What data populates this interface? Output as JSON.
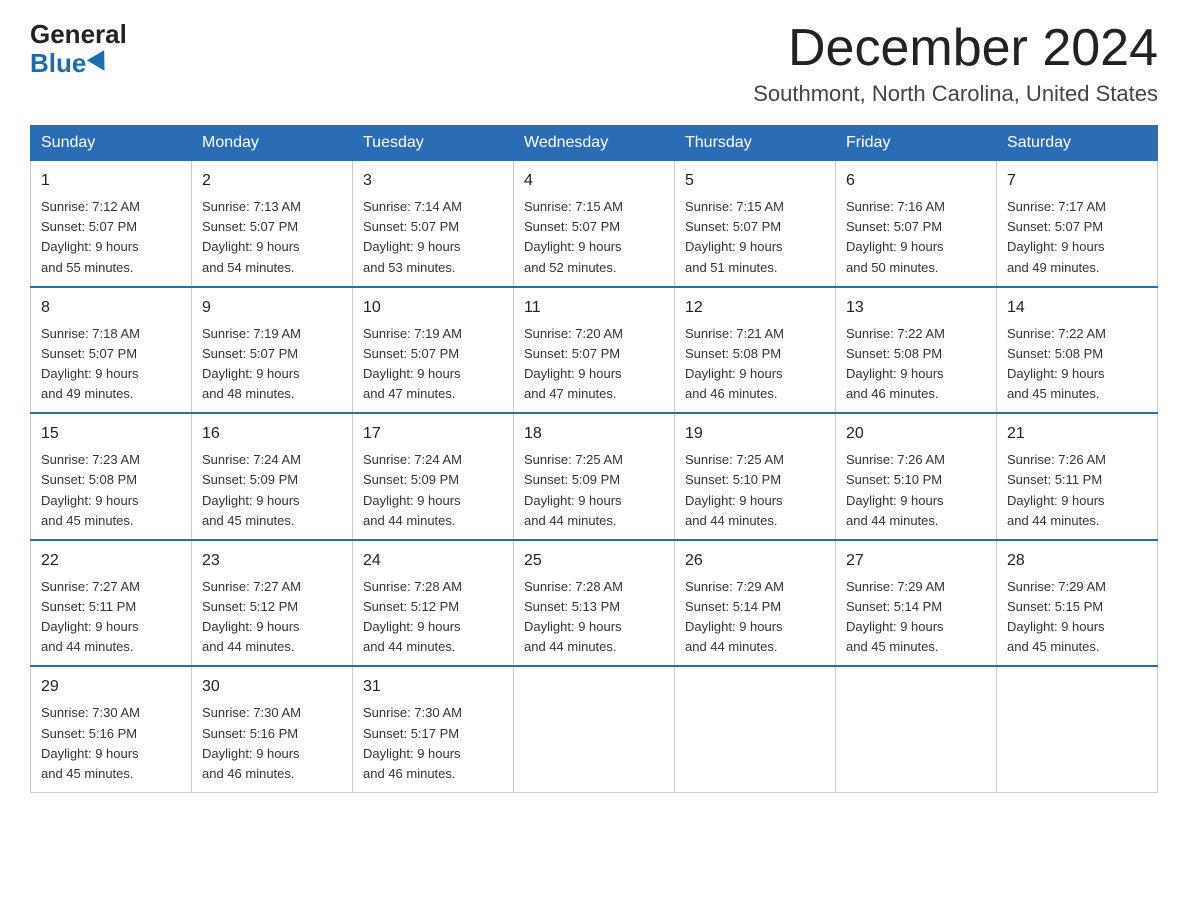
{
  "logo": {
    "general": "General",
    "blue": "Blue"
  },
  "title": "December 2024",
  "subtitle": "Southmont, North Carolina, United States",
  "weekdays": [
    "Sunday",
    "Monday",
    "Tuesday",
    "Wednesday",
    "Thursday",
    "Friday",
    "Saturday"
  ],
  "weeks": [
    [
      {
        "day": "1",
        "sunrise": "7:12 AM",
        "sunset": "5:07 PM",
        "daylight": "9 hours and 55 minutes."
      },
      {
        "day": "2",
        "sunrise": "7:13 AM",
        "sunset": "5:07 PM",
        "daylight": "9 hours and 54 minutes."
      },
      {
        "day": "3",
        "sunrise": "7:14 AM",
        "sunset": "5:07 PM",
        "daylight": "9 hours and 53 minutes."
      },
      {
        "day": "4",
        "sunrise": "7:15 AM",
        "sunset": "5:07 PM",
        "daylight": "9 hours and 52 minutes."
      },
      {
        "day": "5",
        "sunrise": "7:15 AM",
        "sunset": "5:07 PM",
        "daylight": "9 hours and 51 minutes."
      },
      {
        "day": "6",
        "sunrise": "7:16 AM",
        "sunset": "5:07 PM",
        "daylight": "9 hours and 50 minutes."
      },
      {
        "day": "7",
        "sunrise": "7:17 AM",
        "sunset": "5:07 PM",
        "daylight": "9 hours and 49 minutes."
      }
    ],
    [
      {
        "day": "8",
        "sunrise": "7:18 AM",
        "sunset": "5:07 PM",
        "daylight": "9 hours and 49 minutes."
      },
      {
        "day": "9",
        "sunrise": "7:19 AM",
        "sunset": "5:07 PM",
        "daylight": "9 hours and 48 minutes."
      },
      {
        "day": "10",
        "sunrise": "7:19 AM",
        "sunset": "5:07 PM",
        "daylight": "9 hours and 47 minutes."
      },
      {
        "day": "11",
        "sunrise": "7:20 AM",
        "sunset": "5:07 PM",
        "daylight": "9 hours and 47 minutes."
      },
      {
        "day": "12",
        "sunrise": "7:21 AM",
        "sunset": "5:08 PM",
        "daylight": "9 hours and 46 minutes."
      },
      {
        "day": "13",
        "sunrise": "7:22 AM",
        "sunset": "5:08 PM",
        "daylight": "9 hours and 46 minutes."
      },
      {
        "day": "14",
        "sunrise": "7:22 AM",
        "sunset": "5:08 PM",
        "daylight": "9 hours and 45 minutes."
      }
    ],
    [
      {
        "day": "15",
        "sunrise": "7:23 AM",
        "sunset": "5:08 PM",
        "daylight": "9 hours and 45 minutes."
      },
      {
        "day": "16",
        "sunrise": "7:24 AM",
        "sunset": "5:09 PM",
        "daylight": "9 hours and 45 minutes."
      },
      {
        "day": "17",
        "sunrise": "7:24 AM",
        "sunset": "5:09 PM",
        "daylight": "9 hours and 44 minutes."
      },
      {
        "day": "18",
        "sunrise": "7:25 AM",
        "sunset": "5:09 PM",
        "daylight": "9 hours and 44 minutes."
      },
      {
        "day": "19",
        "sunrise": "7:25 AM",
        "sunset": "5:10 PM",
        "daylight": "9 hours and 44 minutes."
      },
      {
        "day": "20",
        "sunrise": "7:26 AM",
        "sunset": "5:10 PM",
        "daylight": "9 hours and 44 minutes."
      },
      {
        "day": "21",
        "sunrise": "7:26 AM",
        "sunset": "5:11 PM",
        "daylight": "9 hours and 44 minutes."
      }
    ],
    [
      {
        "day": "22",
        "sunrise": "7:27 AM",
        "sunset": "5:11 PM",
        "daylight": "9 hours and 44 minutes."
      },
      {
        "day": "23",
        "sunrise": "7:27 AM",
        "sunset": "5:12 PM",
        "daylight": "9 hours and 44 minutes."
      },
      {
        "day": "24",
        "sunrise": "7:28 AM",
        "sunset": "5:12 PM",
        "daylight": "9 hours and 44 minutes."
      },
      {
        "day": "25",
        "sunrise": "7:28 AM",
        "sunset": "5:13 PM",
        "daylight": "9 hours and 44 minutes."
      },
      {
        "day": "26",
        "sunrise": "7:29 AM",
        "sunset": "5:14 PM",
        "daylight": "9 hours and 44 minutes."
      },
      {
        "day": "27",
        "sunrise": "7:29 AM",
        "sunset": "5:14 PM",
        "daylight": "9 hours and 45 minutes."
      },
      {
        "day": "28",
        "sunrise": "7:29 AM",
        "sunset": "5:15 PM",
        "daylight": "9 hours and 45 minutes."
      }
    ],
    [
      {
        "day": "29",
        "sunrise": "7:30 AM",
        "sunset": "5:16 PM",
        "daylight": "9 hours and 45 minutes."
      },
      {
        "day": "30",
        "sunrise": "7:30 AM",
        "sunset": "5:16 PM",
        "daylight": "9 hours and 46 minutes."
      },
      {
        "day": "31",
        "sunrise": "7:30 AM",
        "sunset": "5:17 PM",
        "daylight": "9 hours and 46 minutes."
      },
      null,
      null,
      null,
      null
    ]
  ],
  "labels": {
    "sunrise": "Sunrise:",
    "sunset": "Sunset:",
    "daylight": "Daylight:"
  }
}
